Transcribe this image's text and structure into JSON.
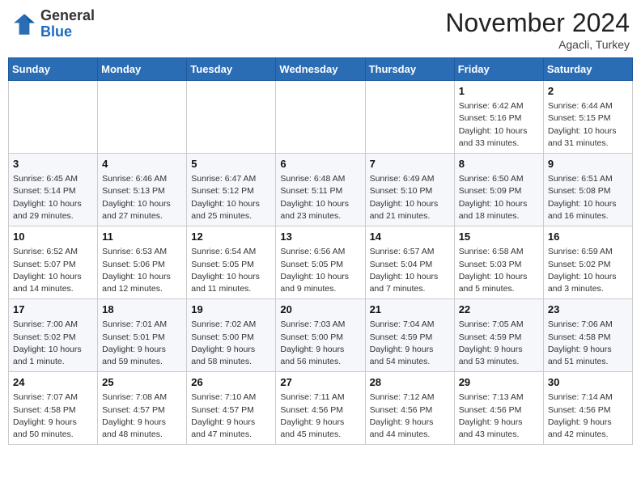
{
  "header": {
    "logo_line1": "General",
    "logo_line2": "Blue",
    "month": "November 2024",
    "location": "Agacli, Turkey"
  },
  "days_of_week": [
    "Sunday",
    "Monday",
    "Tuesday",
    "Wednesday",
    "Thursday",
    "Friday",
    "Saturday"
  ],
  "weeks": [
    [
      null,
      null,
      null,
      null,
      null,
      {
        "day": "1",
        "sunrise": "6:42 AM",
        "sunset": "5:16 PM",
        "daylight": "10 hours and 33 minutes."
      },
      {
        "day": "2",
        "sunrise": "6:44 AM",
        "sunset": "5:15 PM",
        "daylight": "10 hours and 31 minutes."
      }
    ],
    [
      {
        "day": "3",
        "sunrise": "6:45 AM",
        "sunset": "5:14 PM",
        "daylight": "10 hours and 29 minutes."
      },
      {
        "day": "4",
        "sunrise": "6:46 AM",
        "sunset": "5:13 PM",
        "daylight": "10 hours and 27 minutes."
      },
      {
        "day": "5",
        "sunrise": "6:47 AM",
        "sunset": "5:12 PM",
        "daylight": "10 hours and 25 minutes."
      },
      {
        "day": "6",
        "sunrise": "6:48 AM",
        "sunset": "5:11 PM",
        "daylight": "10 hours and 23 minutes."
      },
      {
        "day": "7",
        "sunrise": "6:49 AM",
        "sunset": "5:10 PM",
        "daylight": "10 hours and 21 minutes."
      },
      {
        "day": "8",
        "sunrise": "6:50 AM",
        "sunset": "5:09 PM",
        "daylight": "10 hours and 18 minutes."
      },
      {
        "day": "9",
        "sunrise": "6:51 AM",
        "sunset": "5:08 PM",
        "daylight": "10 hours and 16 minutes."
      }
    ],
    [
      {
        "day": "10",
        "sunrise": "6:52 AM",
        "sunset": "5:07 PM",
        "daylight": "10 hours and 14 minutes."
      },
      {
        "day": "11",
        "sunrise": "6:53 AM",
        "sunset": "5:06 PM",
        "daylight": "10 hours and 12 minutes."
      },
      {
        "day": "12",
        "sunrise": "6:54 AM",
        "sunset": "5:05 PM",
        "daylight": "10 hours and 11 minutes."
      },
      {
        "day": "13",
        "sunrise": "6:56 AM",
        "sunset": "5:05 PM",
        "daylight": "10 hours and 9 minutes."
      },
      {
        "day": "14",
        "sunrise": "6:57 AM",
        "sunset": "5:04 PM",
        "daylight": "10 hours and 7 minutes."
      },
      {
        "day": "15",
        "sunrise": "6:58 AM",
        "sunset": "5:03 PM",
        "daylight": "10 hours and 5 minutes."
      },
      {
        "day": "16",
        "sunrise": "6:59 AM",
        "sunset": "5:02 PM",
        "daylight": "10 hours and 3 minutes."
      }
    ],
    [
      {
        "day": "17",
        "sunrise": "7:00 AM",
        "sunset": "5:02 PM",
        "daylight": "10 hours and 1 minute."
      },
      {
        "day": "18",
        "sunrise": "7:01 AM",
        "sunset": "5:01 PM",
        "daylight": "9 hours and 59 minutes."
      },
      {
        "day": "19",
        "sunrise": "7:02 AM",
        "sunset": "5:00 PM",
        "daylight": "9 hours and 58 minutes."
      },
      {
        "day": "20",
        "sunrise": "7:03 AM",
        "sunset": "5:00 PM",
        "daylight": "9 hours and 56 minutes."
      },
      {
        "day": "21",
        "sunrise": "7:04 AM",
        "sunset": "4:59 PM",
        "daylight": "9 hours and 54 minutes."
      },
      {
        "day": "22",
        "sunrise": "7:05 AM",
        "sunset": "4:59 PM",
        "daylight": "9 hours and 53 minutes."
      },
      {
        "day": "23",
        "sunrise": "7:06 AM",
        "sunset": "4:58 PM",
        "daylight": "9 hours and 51 minutes."
      }
    ],
    [
      {
        "day": "24",
        "sunrise": "7:07 AM",
        "sunset": "4:58 PM",
        "daylight": "9 hours and 50 minutes."
      },
      {
        "day": "25",
        "sunrise": "7:08 AM",
        "sunset": "4:57 PM",
        "daylight": "9 hours and 48 minutes."
      },
      {
        "day": "26",
        "sunrise": "7:10 AM",
        "sunset": "4:57 PM",
        "daylight": "9 hours and 47 minutes."
      },
      {
        "day": "27",
        "sunrise": "7:11 AM",
        "sunset": "4:56 PM",
        "daylight": "9 hours and 45 minutes."
      },
      {
        "day": "28",
        "sunrise": "7:12 AM",
        "sunset": "4:56 PM",
        "daylight": "9 hours and 44 minutes."
      },
      {
        "day": "29",
        "sunrise": "7:13 AM",
        "sunset": "4:56 PM",
        "daylight": "9 hours and 43 minutes."
      },
      {
        "day": "30",
        "sunrise": "7:14 AM",
        "sunset": "4:56 PM",
        "daylight": "9 hours and 42 minutes."
      }
    ]
  ]
}
